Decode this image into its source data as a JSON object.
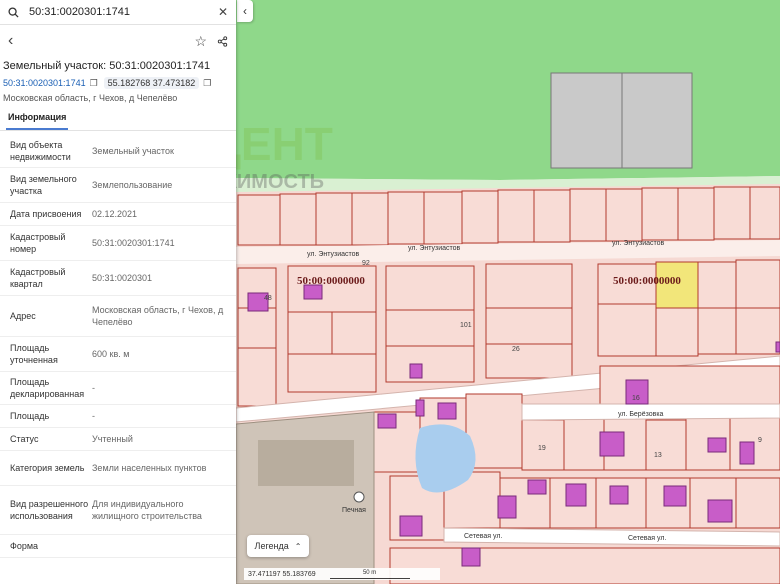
{
  "search": {
    "value": "50:31:0020301:1741"
  },
  "panel": {
    "title": "Земельный участок: 50:31:0020301:1741",
    "cad_number": "50:31:0020301:1741",
    "coords": "55.182768 37.473182",
    "address": "Московская область, г Чехов, д Чепелёво",
    "tab": "Информация",
    "rows": [
      {
        "key": "Вид объекта недвижимости",
        "value": "Земельный участок"
      },
      {
        "key": "Вид земельного участка",
        "value": "Землепользование"
      },
      {
        "key": "Дата присвоения",
        "value": "02.12.2021"
      },
      {
        "key": "Кадастровый номер",
        "value": "50:31:0020301:1741"
      },
      {
        "key": "Кадастровый квартал",
        "value": "50:31:0020301"
      },
      {
        "key": "Адрес",
        "value": "Московская область, г Чехов, д Чепелёво"
      },
      {
        "key": "Площадь уточненная",
        "value": "600 кв. м"
      },
      {
        "key": "Площадь декларированная",
        "value": "-"
      },
      {
        "key": "Площадь",
        "value": "-"
      },
      {
        "key": "Статус",
        "value": "Учтенный"
      },
      {
        "key": "Категория земель",
        "value": "Земли населенных пунктов"
      },
      {
        "key": "Вид разрешенного использования",
        "value": "Для индивидуального жилищного строительства"
      },
      {
        "key": "Форма",
        "value": ""
      }
    ]
  },
  "map": {
    "streets": [
      "ул. Энтузиастов",
      "ул. Энтузиастов",
      "ул. Энтузиастов",
      "ул. Берёзовка",
      "Сетевая ул.",
      "Сетевая ул."
    ],
    "quarter_labels": [
      "50:00:0000000",
      "50:00:0000000"
    ],
    "lot_numbers": [
      "92",
      "101",
      "26",
      "16",
      "19",
      "13",
      "48",
      "9"
    ],
    "poi": "Печная",
    "legend": "Легенда",
    "coords_readout": "37.471197  55.183769",
    "scale_label": "50 m"
  },
  "watermark": {
    "line1": "АКЦЕНТ",
    "line2": "НЕДВИЖИМОСТЬ"
  },
  "colors": {
    "forest": "#8fd88a",
    "parcel_fill": "#f8dcd6",
    "parcel_border": "#b23a2e",
    "building": "#c85dc8",
    "selected": "#f2e67a",
    "link": "#1a5fb4"
  }
}
